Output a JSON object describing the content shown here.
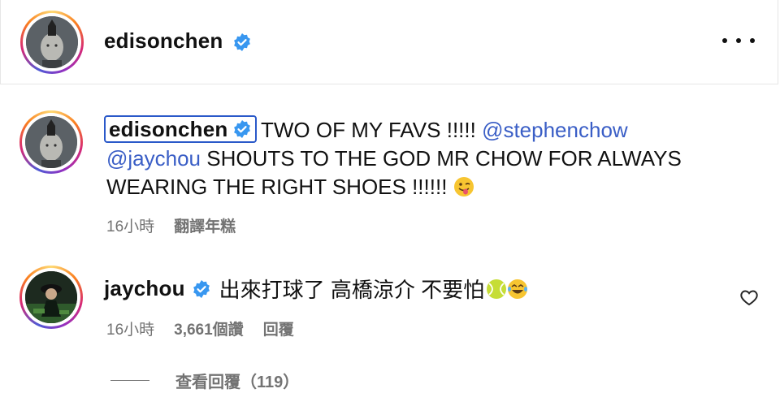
{
  "post": {
    "username": "edisonchen"
  },
  "caption": {
    "username": "edisonchen",
    "text_1": "TWO OF MY FAVS !!!!! ",
    "mention_1": "@stephenchow",
    "mention_2": "@jaychou",
    "text_2": " SHOUTS TO THE GOD MR CHOW FOR ALWAYS WEARING THE RIGHT SHOES !!!!!! ",
    "emoji": "winking-tongue-emoji",
    "time": "16小時",
    "translate": "翻譯年糕"
  },
  "comment": {
    "username": "jaychou",
    "text": "出來打球了 高橋涼介 不要怕",
    "emojis": [
      "tennis-ball-emoji",
      "laughing-tears-emoji"
    ],
    "time": "16小時",
    "likes": "3,661個讚",
    "reply": "回覆",
    "view_replies": "查看回覆（119）"
  },
  "colors": {
    "verified": "#3897f0",
    "mention": "#3a5ec6",
    "meta": "#737373",
    "highlight_border": "#2a59c9"
  }
}
